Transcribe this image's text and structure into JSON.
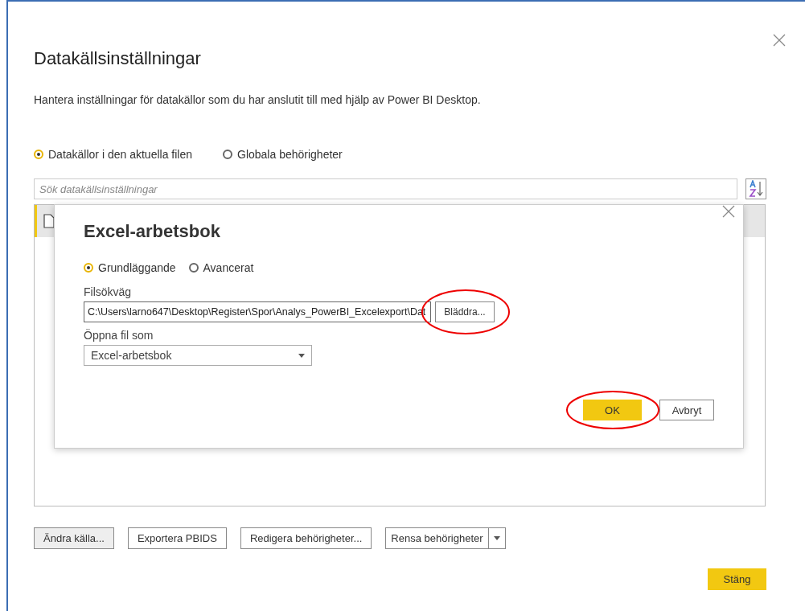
{
  "window": {
    "title": "Datakällsinställningar",
    "description": "Hantera inställningar för datakällor som du har anslutit till med hjälp av Power BI Desktop."
  },
  "scope_options": [
    {
      "label": "Datakällor i den aktuella filen",
      "selected": true
    },
    {
      "label": "Globala behörigheter",
      "selected": false
    }
  ],
  "search": {
    "placeholder": "Sök datakällsinställningar"
  },
  "sources": [
    {
      "selected": true
    }
  ],
  "dialog": {
    "title": "Excel-arbetsbok",
    "modes": [
      {
        "label": "Grundläggande",
        "selected": true
      },
      {
        "label": "Avancerat",
        "selected": false
      }
    ],
    "path_label": "Filsökväg",
    "path_value": "C:\\Users\\larno647\\Desktop\\Register\\Spor\\Analys_PowerBI_Excelexport\\Dat",
    "browse": {
      "label": "Bläddra...",
      "highlighted": true
    },
    "open_as_label": "Öppna fil som",
    "open_as_value": "Excel-arbetsbok",
    "buttons": [
      {
        "label": "OK",
        "primary": true,
        "highlighted": true
      },
      {
        "label": "Avbryt",
        "primary": false,
        "highlighted": false
      }
    ]
  },
  "actions": [
    {
      "label": "Ändra källa...",
      "kind": "shaded"
    },
    {
      "label": "Exportera PBIDS",
      "kind": "plain"
    },
    {
      "label": "Redigera behörigheter...",
      "kind": "plain"
    },
    {
      "label": "Rensa behörigheter",
      "kind": "split"
    }
  ],
  "close_button": {
    "label": "Stäng"
  }
}
